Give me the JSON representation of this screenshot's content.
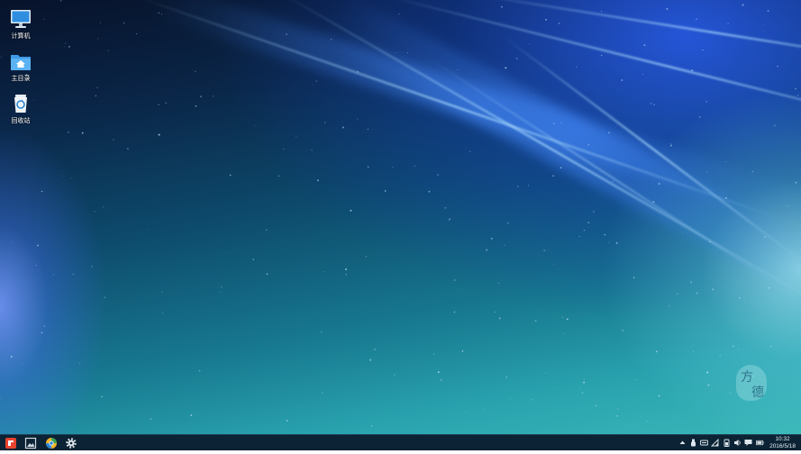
{
  "desktop": {
    "icons": [
      {
        "label": "计算机",
        "icon": "computer-icon"
      },
      {
        "label": "主目录",
        "icon": "home-folder-icon"
      },
      {
        "label": "回收站",
        "icon": "trash-icon"
      }
    ],
    "watermark": {
      "top_char": "方",
      "bottom_char": "德"
    }
  },
  "taskbar": {
    "launchers": [
      {
        "icon": "start-menu-icon",
        "color": "#e8432f"
      },
      {
        "icon": "image-viewer-icon",
        "color": "#cfd8de"
      },
      {
        "icon": "browser-icon",
        "color": "#f5b428"
      },
      {
        "icon": "settings-gear-icon",
        "color": "#e6ecf0"
      }
    ],
    "tray_icons": [
      "tray-up-arrow-icon",
      "usb-icon",
      "keyboard-icon",
      "signal-icon",
      "battery-alt-icon",
      "volume-icon",
      "notification-icon",
      "battery-icon"
    ],
    "clock": {
      "time": "10:32",
      "date": "2016/5/18"
    }
  }
}
